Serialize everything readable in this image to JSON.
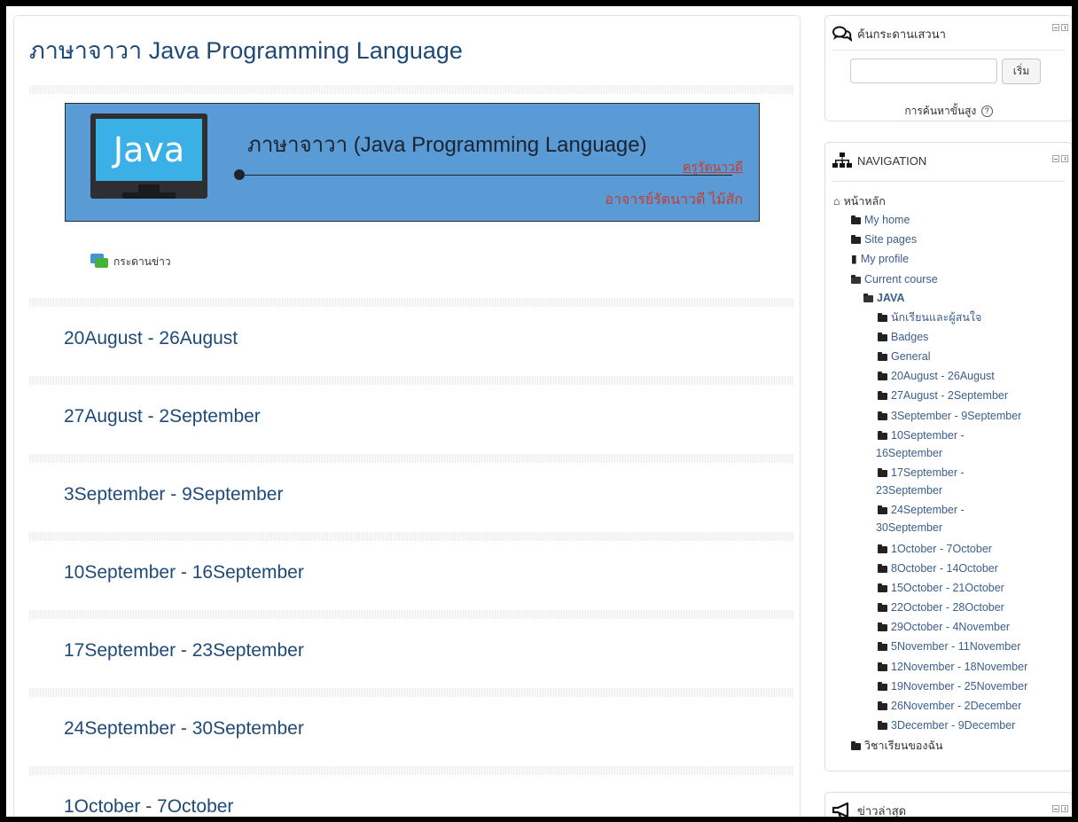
{
  "course": {
    "title": "ภาษาจาวา Java Programming Language",
    "banner": {
      "screen_text": "Java",
      "title": "ภาษาจาวา (Java Programming Language)",
      "code": "ครูรัตนาวดี",
      "author": "อาจารย์รัตนาวดี ไม้สัก"
    },
    "forum_label": "กระดานข่าว"
  },
  "sections": [
    "20August - 26August",
    "27August - 2September",
    "3September - 9September",
    "10September - 16September",
    "17September - 23September",
    "24September - 30September",
    "1October - 7October"
  ],
  "search_block": {
    "title": "ค้นกระดานเสวนา",
    "button": "เริ่ม",
    "advanced": "การค้นหาขั้นสูง",
    "help": "?",
    "input_value": ""
  },
  "navigation": {
    "title": "NAVIGATION",
    "home": "หน้าหลัก",
    "my_home": "My home",
    "site_pages": "Site pages",
    "my_profile": "My profile",
    "current_course": "Current course",
    "course_code": "JAVA",
    "course_items": [
      "นักเรียนและผู้สนใจ",
      "Badges",
      "General",
      "20August - 26August",
      "27August - 2September",
      "3September - 9September",
      "10September -",
      "16September",
      "17September -",
      "23September",
      "24September -",
      "30September",
      "1October - 7October",
      "8October - 14October",
      "15October - 21October",
      "22October - 28October",
      "29October - 4November",
      "5November - 11November",
      "12November - 18November",
      "19November - 25November",
      "26November - 2December",
      "3December - 9December"
    ],
    "my_courses": "วิชาเรียนของฉัน"
  },
  "news_block": {
    "title": "ข่าวล่าสุด"
  },
  "colors": {
    "link": "#1e4a78",
    "banner": "#5b9bd5",
    "accent_red": "#c63b2e"
  },
  "icons": [
    "comments-icon",
    "sitemap-icon",
    "bullhorn-icon",
    "home-icon",
    "folder-icon",
    "user-icon"
  ]
}
